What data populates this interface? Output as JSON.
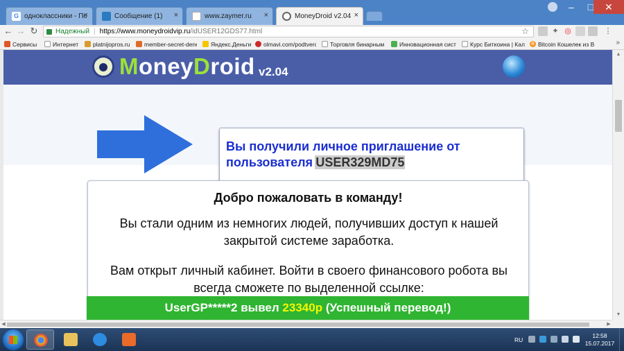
{
  "browser": {
    "tabs": [
      {
        "label": "одноклассники - Поиск",
        "favicon": "google-icon",
        "active": false
      },
      {
        "label": "Сообщение (1)",
        "favicon": "mail-icon",
        "active": false
      },
      {
        "label": "www.zaymer.ru",
        "favicon": "page-icon",
        "active": false
      },
      {
        "label": "MoneyDroid v2.04",
        "favicon": "moneydroid-icon",
        "active": true
      }
    ],
    "window_controls": {
      "minimize": "–",
      "maximize": "□",
      "close": "✕"
    },
    "address": {
      "secure_label": "Надежный",
      "url_host": "https://www.moneydroidvip.ru",
      "url_path": "/idUSER12GDS77.html"
    },
    "bookmarks": [
      {
        "label": "Сервисы",
        "icon": "apps-icon",
        "color": "#e0572a"
      },
      {
        "label": "Интернет",
        "icon": "page-icon",
        "color": "#ffffff"
      },
      {
        "label": "platnijopros.ru",
        "icon": "site-icon",
        "color": "#d99b2b"
      },
      {
        "label": "member-secret-dene",
        "icon": "site-icon",
        "color": "#e06a2a"
      },
      {
        "label": "Яндекс.Деньги",
        "icon": "yandex-icon",
        "color": "#f7c600"
      },
      {
        "label": "olmavi.com/podtverd",
        "icon": "site-icon",
        "color": "#cc2a2a"
      },
      {
        "label": "Торговля бинарным",
        "icon": "page-icon",
        "color": "#ffffff"
      },
      {
        "label": "Инновационная сист",
        "icon": "leaf-icon",
        "color": "#4caf50"
      },
      {
        "label": "Курс Биткоина | Кал",
        "icon": "page-icon",
        "color": "#ffffff"
      },
      {
        "label": "Bitcoin Кошелек из В",
        "icon": "bitcoin-icon",
        "color": "#f7931a"
      }
    ],
    "bookmarks_more": "»"
  },
  "page": {
    "logo": {
      "prefix_letter": "M",
      "part1": "oney",
      "letter2": "D",
      "part2": "roid",
      "version": "v2.04"
    },
    "invite": {
      "text": "Вы получили личное приглашение от пользователя",
      "username": "USER329MD75"
    },
    "welcome": {
      "title": "Добро пожаловать в команду!",
      "paragraph1": "Вы стали одним из немногих людей, получивших доступ к нашей закрытой системе заработка.",
      "paragraph2": "Вам открыт личный кабинет. Войти в своего финансового робота вы всегда сможете по выделенной ссылке:"
    },
    "banner": {
      "user": "UserGP*****2 вывел",
      "amount": "23340р",
      "suffix": "(Успешный перевод!)"
    },
    "colors": {
      "header_bg": "#4a5ea8",
      "logo_green": "#9be13a",
      "invite_text": "#1a2fd0",
      "arrow_blue": "#2f6fdc",
      "banner_green": "#2fb531",
      "banner_amount": "#f6f600"
    }
  },
  "taskbar": {
    "items": [
      {
        "name": "chrome-icon",
        "color": "#e8b42a",
        "active": true
      },
      {
        "name": "explorer-folder-icon",
        "color": "#e7c25c",
        "active": false
      },
      {
        "name": "internet-explorer-icon",
        "color": "#2d8be0",
        "active": false
      },
      {
        "name": "media-player-icon",
        "color": "#e86b2a",
        "active": false
      }
    ],
    "tray": {
      "language": "RU",
      "time": "12:58",
      "date": "15.07.2017"
    }
  }
}
